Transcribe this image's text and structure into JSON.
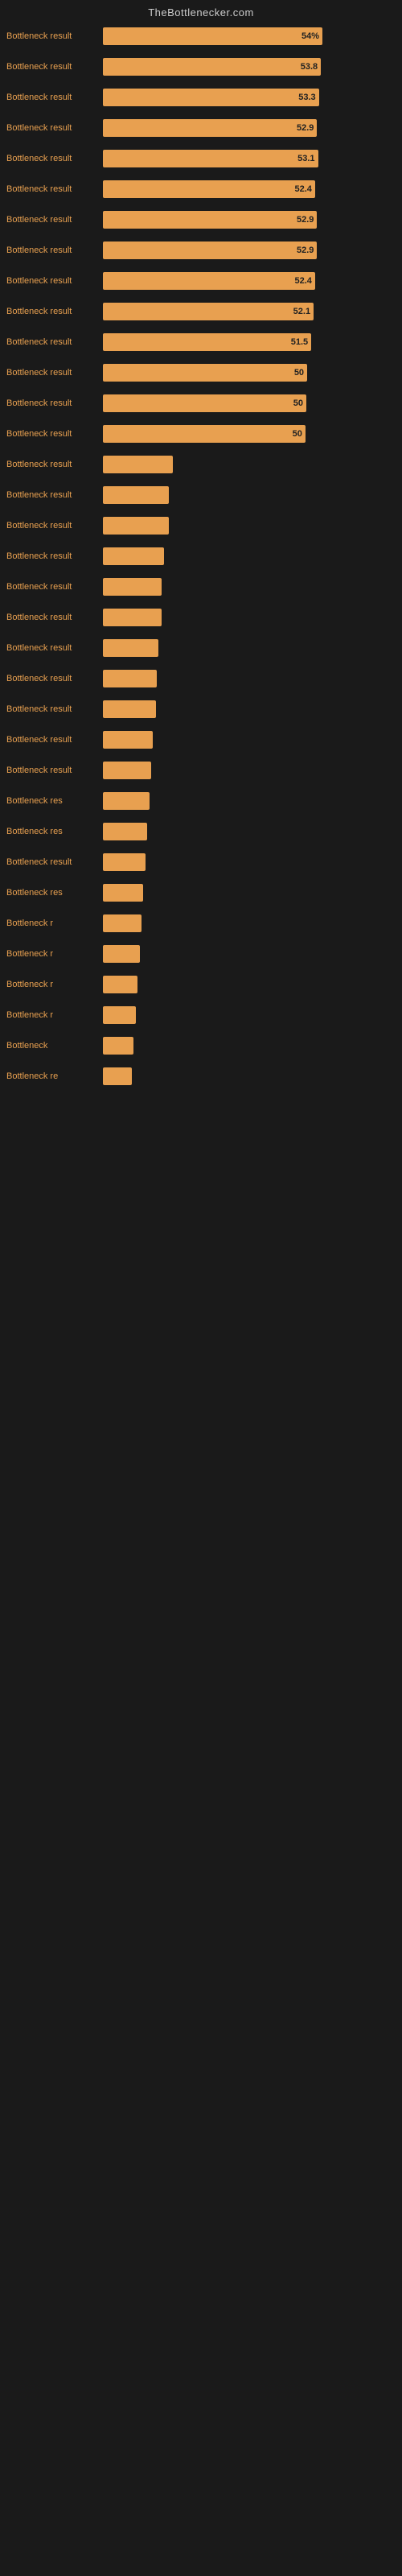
{
  "header": {
    "title": "TheBottlenecker.com"
  },
  "bars": [
    {
      "label": "Bottleneck result",
      "value": 54.0,
      "display": "54%",
      "width_pct": 75
    },
    {
      "label": "Bottleneck result",
      "value": 53.8,
      "display": "53.8",
      "width_pct": 74.5
    },
    {
      "label": "Bottleneck result",
      "value": 53.3,
      "display": "53.3",
      "width_pct": 73.8
    },
    {
      "label": "Bottleneck result",
      "value": 52.9,
      "display": "52.9",
      "width_pct": 73.2
    },
    {
      "label": "Bottleneck result",
      "value": 53.1,
      "display": "53.1",
      "width_pct": 73.5
    },
    {
      "label": "Bottleneck result",
      "value": 52.4,
      "display": "52.4",
      "width_pct": 72.5
    },
    {
      "label": "Bottleneck result",
      "value": 52.9,
      "display": "52.9",
      "width_pct": 73.2
    },
    {
      "label": "Bottleneck result",
      "value": 52.9,
      "display": "52.9",
      "width_pct": 73.2
    },
    {
      "label": "Bottleneck result",
      "value": 52.4,
      "display": "52.4",
      "width_pct": 72.5
    },
    {
      "label": "Bottleneck result",
      "value": 52.1,
      "display": "52.1",
      "width_pct": 72.0
    },
    {
      "label": "Bottleneck result",
      "value": 51.5,
      "display": "51.5",
      "width_pct": 71.2
    },
    {
      "label": "Bottleneck result",
      "value": 50.5,
      "display": "50",
      "width_pct": 69.8
    },
    {
      "label": "Bottleneck result",
      "value": 50.3,
      "display": "50",
      "width_pct": 69.5
    },
    {
      "label": "Bottleneck result",
      "value": 50.1,
      "display": "50",
      "width_pct": 69.2
    },
    {
      "label": "Bottleneck result",
      "value": 18,
      "display": "",
      "width_pct": 24
    },
    {
      "label": "Bottleneck result",
      "value": 17,
      "display": "",
      "width_pct": 22.5
    },
    {
      "label": "Bottleneck result",
      "value": 17,
      "display": "",
      "width_pct": 22.5
    },
    {
      "label": "Bottleneck result",
      "value": 16,
      "display": "",
      "width_pct": 21
    },
    {
      "label": "Bottleneck result",
      "value": 15,
      "display": "",
      "width_pct": 20
    },
    {
      "label": "Bottleneck result",
      "value": 15,
      "display": "",
      "width_pct": 20
    },
    {
      "label": "Bottleneck result",
      "value": 14.5,
      "display": "",
      "width_pct": 19
    },
    {
      "label": "Bottleneck result",
      "value": 14,
      "display": "",
      "width_pct": 18.5
    },
    {
      "label": "Bottleneck result",
      "value": 13.5,
      "display": "",
      "width_pct": 18
    },
    {
      "label": "Bottleneck result",
      "value": 13,
      "display": "",
      "width_pct": 17
    },
    {
      "label": "Bottleneck result",
      "value": 12.5,
      "display": "",
      "width_pct": 16.5
    },
    {
      "label": "Bottleneck res",
      "value": 12,
      "display": "",
      "width_pct": 15.8
    },
    {
      "label": "Bottleneck res",
      "value": 11.5,
      "display": "",
      "width_pct": 15.2
    },
    {
      "label": "Bottleneck result",
      "value": 11,
      "display": "",
      "width_pct": 14.5
    },
    {
      "label": "Bottleneck res",
      "value": 10.5,
      "display": "",
      "width_pct": 13.8
    },
    {
      "label": "Bottleneck r",
      "value": 10,
      "display": "",
      "width_pct": 13.2
    },
    {
      "label": "Bottleneck r",
      "value": 9.5,
      "display": "",
      "width_pct": 12.5
    },
    {
      "label": "Bottleneck r",
      "value": 9,
      "display": "",
      "width_pct": 11.8
    },
    {
      "label": "Bottleneck r",
      "value": 8.5,
      "display": "",
      "width_pct": 11.2
    },
    {
      "label": "Bottleneck",
      "value": 8,
      "display": "",
      "width_pct": 10.5
    },
    {
      "label": "Bottleneck re",
      "value": 7.5,
      "display": "",
      "width_pct": 9.8
    }
  ]
}
